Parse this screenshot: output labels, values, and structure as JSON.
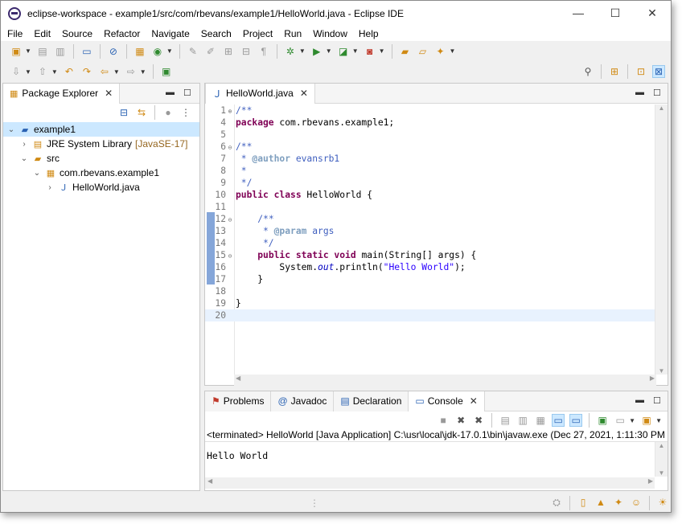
{
  "window": {
    "title": "eclipse-workspace - example1/src/com/rbevans/example1/HelloWorld.java - Eclipse IDE",
    "minimize": "—",
    "maximize": "☐",
    "close": "✕"
  },
  "menu": [
    "File",
    "Edit",
    "Source",
    "Refactor",
    "Navigate",
    "Search",
    "Project",
    "Run",
    "Window",
    "Help"
  ],
  "package_explorer": {
    "tab_label": "Package Explorer",
    "tree": [
      {
        "label": "example1",
        "extra": "",
        "depth": 0,
        "expanded": true,
        "icon": "project-icon"
      },
      {
        "label": "JRE System Library",
        "extra": "[JavaSE-17]",
        "depth": 1,
        "expanded": false,
        "icon": "library-icon"
      },
      {
        "label": "src",
        "extra": "",
        "depth": 1,
        "expanded": true,
        "icon": "source-folder-icon"
      },
      {
        "label": "com.rbevans.example1",
        "extra": "",
        "depth": 2,
        "expanded": true,
        "icon": "package-icon"
      },
      {
        "label": "HelloWorld.java",
        "extra": "",
        "depth": 3,
        "expanded": false,
        "icon": "java-file-icon"
      }
    ]
  },
  "editor": {
    "tab_label": "HelloWorld.java",
    "lines": [
      {
        "n": "1",
        "fold": "plus",
        "html": "<span class='cm'>/**</span>"
      },
      {
        "n": "4",
        "fold": "",
        "html": "<span class='kw'>package</span> com.rbevans.example1;"
      },
      {
        "n": "5",
        "fold": "",
        "html": ""
      },
      {
        "n": "6",
        "fold": "minus",
        "html": "<span class='cm'>/**</span>"
      },
      {
        "n": "7",
        "fold": "",
        "html": "<span class='cm'> * </span><span class='tag'>@author</span><span class='cm'> evansrb1</span>"
      },
      {
        "n": "8",
        "fold": "",
        "html": "<span class='cm'> *</span>"
      },
      {
        "n": "9",
        "fold": "",
        "html": "<span class='cm'> */</span>"
      },
      {
        "n": "10",
        "fold": "",
        "html": "<span class='kw'>public class</span> HelloWorld {"
      },
      {
        "n": "11",
        "fold": "",
        "html": ""
      },
      {
        "n": "12",
        "fold": "minus",
        "html": "    <span class='cm'>/**</span>"
      },
      {
        "n": "13",
        "fold": "",
        "html": "<span class='cm'>     * </span><span class='tag'>@param</span><span class='cm'> args</span>"
      },
      {
        "n": "14",
        "fold": "",
        "html": "<span class='cm'>     */</span>"
      },
      {
        "n": "15",
        "fold": "minus",
        "html": "    <span class='kw'>public static void</span> main(String[] args) {"
      },
      {
        "n": "16",
        "fold": "",
        "html": "        System.<span class='it'>out</span>.println(<span class='str'>\"Hello World\"</span>);"
      },
      {
        "n": "17",
        "fold": "",
        "html": "    }"
      },
      {
        "n": "18",
        "fold": "",
        "html": ""
      },
      {
        "n": "19",
        "fold": "",
        "html": "}"
      },
      {
        "n": "20",
        "fold": "",
        "html": ""
      }
    ]
  },
  "bottom_tabs": [
    {
      "label": "Problems",
      "icon": "problems-icon",
      "active": false
    },
    {
      "label": "Javadoc",
      "icon": "javadoc-icon",
      "active": false
    },
    {
      "label": "Declaration",
      "icon": "declaration-icon",
      "active": false
    },
    {
      "label": "Console",
      "icon": "console-icon",
      "active": true
    }
  ],
  "console": {
    "header": "<terminated> HelloWorld [Java Application] C:\\usr\\local\\jdk-17.0.1\\bin\\javaw.exe  (Dec 27, 2021, 1:11:30 PM -",
    "output": "Hello World"
  }
}
